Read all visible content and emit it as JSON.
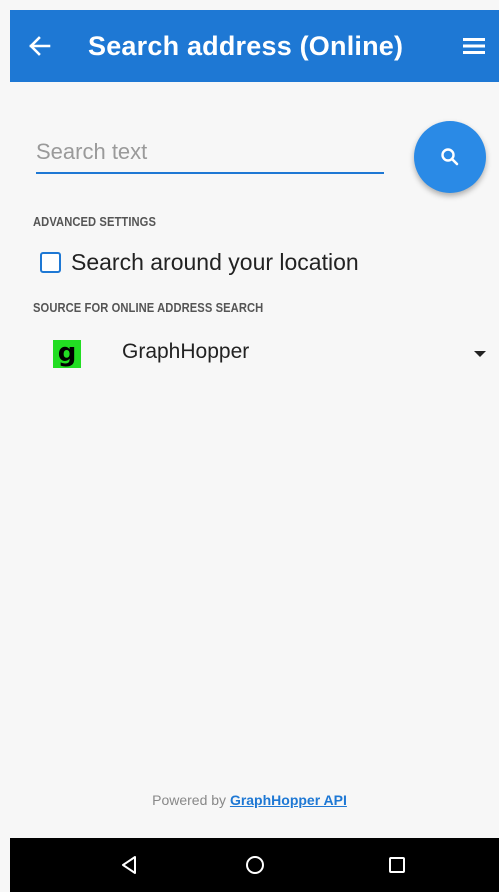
{
  "app_bar": {
    "title": "Search address (Online)",
    "color": "#1e78d4"
  },
  "search": {
    "placeholder": "Search text",
    "value": ""
  },
  "advanced_settings": {
    "header": "ADVANCED SETTINGS",
    "checkbox_label": "Search around your location",
    "checked": false
  },
  "source": {
    "header": "SOURCE FOR ONLINE ADDRESS SEARCH",
    "logo_letter": "g",
    "selected": "GraphHopper"
  },
  "footer": {
    "powered_prefix": "Powered by",
    "powered_link": "GraphHopper API"
  },
  "icons": {
    "back": "back-arrow-icon",
    "menu": "hamburger-menu-icon",
    "search": "search-icon",
    "dropdown": "dropdown-arrow-icon",
    "nav_back": "nav-back-icon",
    "nav_home": "nav-home-icon",
    "nav_recents": "nav-recents-icon"
  }
}
